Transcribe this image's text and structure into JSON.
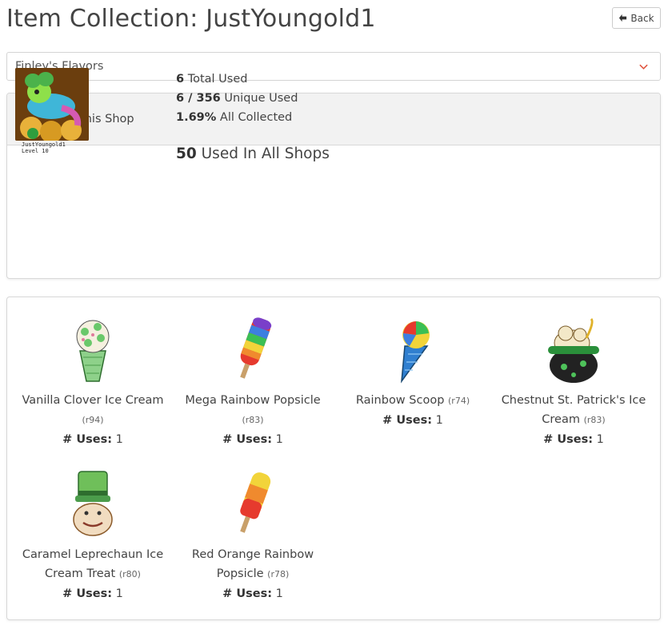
{
  "header": {
    "title": "Item Collection: JustYoungold1",
    "back_label": "Back"
  },
  "shop_select": {
    "selected": "Finley's Flavors"
  },
  "stats": {
    "heading": "Stats For This Shop",
    "avatar_name": "JustYoungold1",
    "avatar_level": "Level 10",
    "total_used_value": "6",
    "total_used_label": "Total Used",
    "unique_used_value": "6 / 356",
    "unique_used_label": "Unique Used",
    "collected_value": "1.69%",
    "collected_label": "All Collected",
    "all_shops_value": "50",
    "all_shops_label": "Used In All Shops"
  },
  "items": [
    {
      "name": "Vanilla Clover Ice Cream",
      "rarity": "(r94)",
      "uses_label": "# Uses:",
      "uses": "1",
      "icon": "clover-ice-cream-cone"
    },
    {
      "name": "Mega Rainbow Popsicle",
      "rarity": "(r83)",
      "uses_label": "# Uses:",
      "uses": "1",
      "icon": "rainbow-popsicle"
    },
    {
      "name": "Rainbow Scoop",
      "rarity": "(r74)",
      "uses_label": "# Uses:",
      "uses": "1",
      "icon": "rainbow-scoop-cone"
    },
    {
      "name": "Chestnut St. Patrick's Ice Cream",
      "rarity": "(r83)",
      "uses_label": "# Uses:",
      "uses": "1",
      "icon": "cauldron-ice-cream"
    },
    {
      "name": "Caramel Leprechaun Ice Cream Treat",
      "rarity": "(r80)",
      "uses_label": "# Uses:",
      "uses": "1",
      "icon": "leprechaun-ice-cream"
    },
    {
      "name": "Red Orange Rainbow Popsicle",
      "rarity": "(r78)",
      "uses_label": "# Uses:",
      "uses": "1",
      "icon": "red-orange-popsicle"
    }
  ],
  "colors": {
    "accent_chevron": "#e0533d",
    "card_header_bg": "#f2f2f2",
    "border": "#d8d8d8"
  }
}
